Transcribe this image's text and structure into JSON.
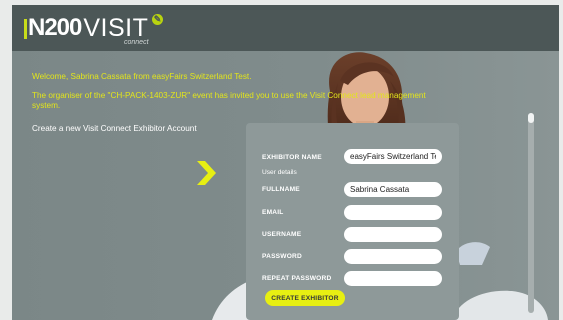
{
  "brand": {
    "logo_n200": "N200",
    "logo_visit": "VISIT",
    "logo_connect": "connect"
  },
  "colors": {
    "header_bg": "#4c5757",
    "page_bg": "#7a8686",
    "accent_yellow": "#e3e61b",
    "button_bg": "#e7ef12",
    "card_bg": "#8e9999"
  },
  "messages": {
    "welcome": "Welcome, Sabrina Cassata from easyFairs Switzerland Test.",
    "invite_line1": "The organiser of the \"CH-PACK-1403-ZUR\" event has invited you to use the Visit Connect lead management",
    "invite_line2": "system.",
    "create_account": "Create a new Visit Connect Exhibitor Account"
  },
  "form": {
    "exhibitor_name_label": "EXHIBITOR NAME",
    "exhibitor_name_value": "easyFairs Switzerland Te",
    "user_details_label": "User details",
    "fullname_label": "FULLNAME",
    "fullname_value": "Sabrina Cassata",
    "email_label": "EMAIL",
    "email_value": "",
    "username_label": "USERNAME",
    "username_value": "",
    "password_label": "PASSWORD",
    "password_value": "",
    "repeat_password_label": "REPEAT PASSWORD",
    "repeat_password_value": "",
    "submit_label": "CREATE EXHIBITOR"
  },
  "icons": {
    "arrow": "chevron-right-icon",
    "badge": "leaf-icon"
  }
}
